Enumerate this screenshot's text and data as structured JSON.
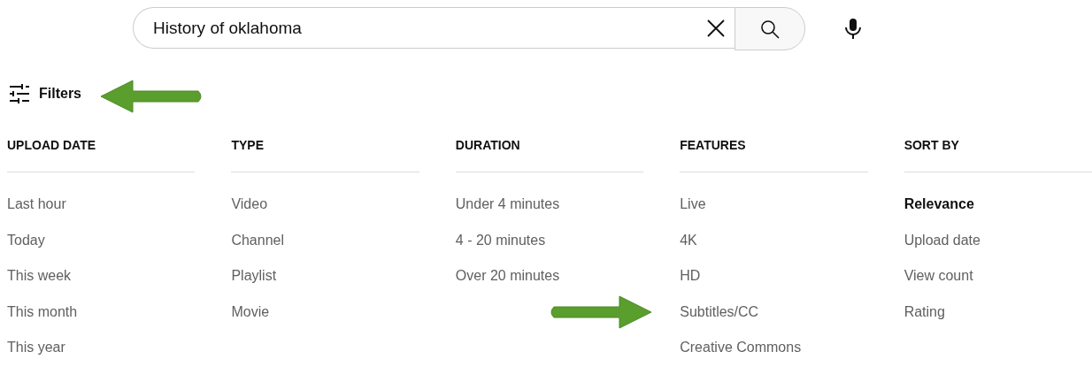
{
  "search": {
    "value": "History of oklahoma"
  },
  "filters_button": {
    "label": "Filters",
    "arrow": true
  },
  "groups": [
    {
      "title": "UPLOAD DATE",
      "options": [
        {
          "label": "Last hour",
          "selected": false,
          "arrow": false
        },
        {
          "label": "Today",
          "selected": false,
          "arrow": false
        },
        {
          "label": "This week",
          "selected": false,
          "arrow": false
        },
        {
          "label": "This month",
          "selected": false,
          "arrow": false
        },
        {
          "label": "This year",
          "selected": false,
          "arrow": false
        }
      ]
    },
    {
      "title": "TYPE",
      "options": [
        {
          "label": "Video",
          "selected": false,
          "arrow": false
        },
        {
          "label": "Channel",
          "selected": false,
          "arrow": false
        },
        {
          "label": "Playlist",
          "selected": false,
          "arrow": false
        },
        {
          "label": "Movie",
          "selected": false,
          "arrow": false
        }
      ]
    },
    {
      "title": "DURATION",
      "options": [
        {
          "label": "Under 4 minutes",
          "selected": false,
          "arrow": false
        },
        {
          "label": "4 - 20 minutes",
          "selected": false,
          "arrow": false
        },
        {
          "label": "Over 20 minutes",
          "selected": false,
          "arrow": false
        }
      ]
    },
    {
      "title": "FEATURES",
      "options": [
        {
          "label": "Live",
          "selected": false,
          "arrow": false
        },
        {
          "label": "4K",
          "selected": false,
          "arrow": false
        },
        {
          "label": "HD",
          "selected": false,
          "arrow": false
        },
        {
          "label": "Subtitles/CC",
          "selected": false,
          "arrow": true
        },
        {
          "label": "Creative Commons",
          "selected": false,
          "arrow": false
        }
      ]
    },
    {
      "title": "SORT BY",
      "options": [
        {
          "label": "Relevance",
          "selected": true,
          "arrow": false
        },
        {
          "label": "Upload date",
          "selected": false,
          "arrow": false
        },
        {
          "label": "View count",
          "selected": false,
          "arrow": false
        },
        {
          "label": "Rating",
          "selected": false,
          "arrow": false
        }
      ]
    }
  ]
}
